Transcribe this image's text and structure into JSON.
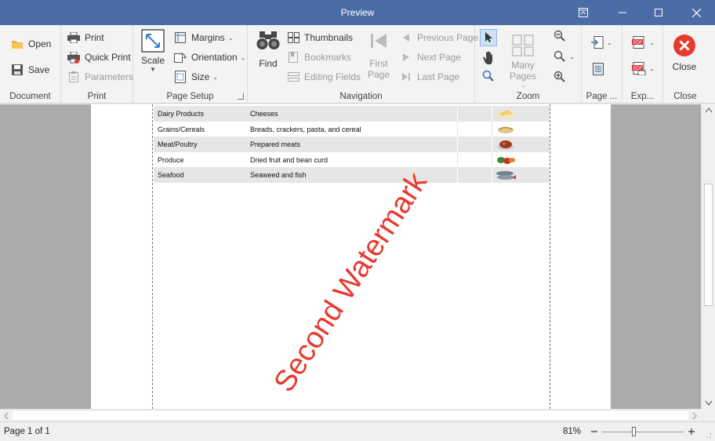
{
  "window": {
    "title": "Preview"
  },
  "ribbon": {
    "document": {
      "label": "Document",
      "open": "Open",
      "save": "Save"
    },
    "print": {
      "label": "Print",
      "print": "Print",
      "quick_print": "Quick Print",
      "parameters": "Parameters"
    },
    "page_setup": {
      "label": "Page Setup",
      "scale": "Scale",
      "margins": "Margins",
      "orientation": "Orientation",
      "size": "Size"
    },
    "navigation": {
      "label": "Navigation",
      "find": "Find",
      "thumbnails": "Thumbnails",
      "bookmarks": "Bookmarks",
      "editing_fields": "Editing Fields",
      "first_page_1": "First",
      "first_page_2": "Page",
      "previous_page": "Previous Page",
      "next_page": "Next  Page",
      "last_page": "Last  Page"
    },
    "zoom": {
      "label": "Zoom",
      "many_pages": "Many Pages"
    },
    "page_bg": {
      "label": "Page ..."
    },
    "export": {
      "label": "Exp..."
    },
    "close": {
      "label": "Close",
      "button": "Close"
    }
  },
  "table": {
    "rows": [
      {
        "category": "Dairy Products",
        "description": "Cheeses",
        "image": "cheese-image"
      },
      {
        "category": "Grains/Cereals",
        "description": "Breads, crackers, pasta, and cereal",
        "image": "bread-image"
      },
      {
        "category": "Meat/Poultry",
        "description": "Prepared meats",
        "image": "meat-image"
      },
      {
        "category": "Produce",
        "description": "Dried fruit and bean curd",
        "image": "produce-image"
      },
      {
        "category": "Seafood",
        "description": "Seaweed and fish",
        "image": "fish-image"
      }
    ]
  },
  "watermark": {
    "text": "Second Watermark",
    "color": "#e8392f"
  },
  "status": {
    "page": "Page 1 of 1",
    "zoom": "81%"
  },
  "colors": {
    "titlebar": "#4a6da7",
    "close_red": "#e8392f",
    "pdf_red": "#d9363e",
    "accent_blue": "#3a7bc8"
  }
}
